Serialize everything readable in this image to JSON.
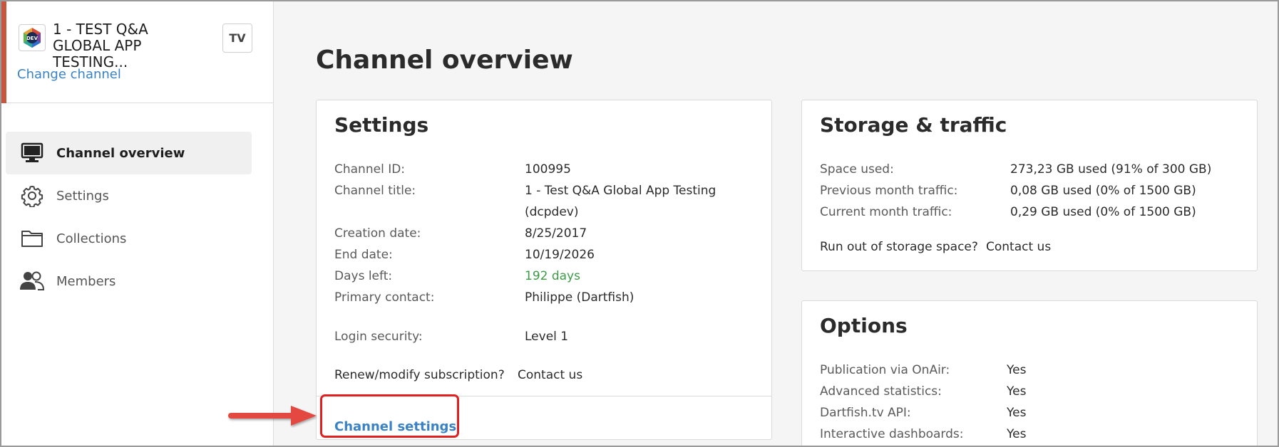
{
  "sidebar": {
    "channel_name": "1 - TEST Q&A GLOBAL APP TESTING...",
    "tv_label": "TV",
    "change_channel": "Change channel",
    "logo_text": "DEV",
    "items": [
      {
        "label": "Channel overview",
        "icon": "monitor-icon",
        "active": true
      },
      {
        "label": "Settings",
        "icon": "gear-icon",
        "active": false
      },
      {
        "label": "Collections",
        "icon": "folder-icon",
        "active": false
      },
      {
        "label": "Members",
        "icon": "members-icon",
        "active": false
      }
    ]
  },
  "main": {
    "page_title": "Channel overview",
    "settings_card": {
      "title": "Settings",
      "rows": [
        {
          "label": "Channel ID:",
          "value": "100995"
        },
        {
          "label": "Channel title:",
          "value": "1 - Test Q&A Global App Testing",
          "value2": "(dcpdev)"
        },
        {
          "label": "Creation date:",
          "value": "8/25/2017"
        },
        {
          "label": "End date:",
          "value": "10/19/2026"
        },
        {
          "label": "Days left:",
          "value": "192 days"
        },
        {
          "label": "Primary contact:",
          "value": "Philippe (Dartfish)"
        },
        {
          "label": "Login security:",
          "value": "Level 1"
        }
      ],
      "renew_text": "Renew/modify subscription?",
      "contact_link": "Contact us",
      "channel_settings_link": "Channel settings"
    },
    "storage_card": {
      "title": "Storage & traffic",
      "rows": [
        {
          "label": "Space used:",
          "value": "273,23 GB used (91% of 300 GB)"
        },
        {
          "label": "Previous month traffic:",
          "value": "0,08 GB used (0% of 1500 GB)"
        },
        {
          "label": "Current month traffic:",
          "value": "0,29 GB used (0% of 1500 GB)"
        }
      ],
      "run_out_text": "Run out of storage space?",
      "contact_link": "Contact us"
    },
    "options_card": {
      "title": "Options",
      "rows": [
        {
          "label": "Publication via OnAir:",
          "value": "Yes"
        },
        {
          "label": "Advanced statistics:",
          "value": "Yes"
        },
        {
          "label": "Dartfish.tv API:",
          "value": "Yes"
        },
        {
          "label": "Interactive dashboards:",
          "value": "Yes"
        }
      ]
    }
  },
  "colors": {
    "accent": "#c8553d",
    "link": "#3a82c4",
    "days_left": "#3d9a45",
    "annotation": "#e0211f"
  }
}
